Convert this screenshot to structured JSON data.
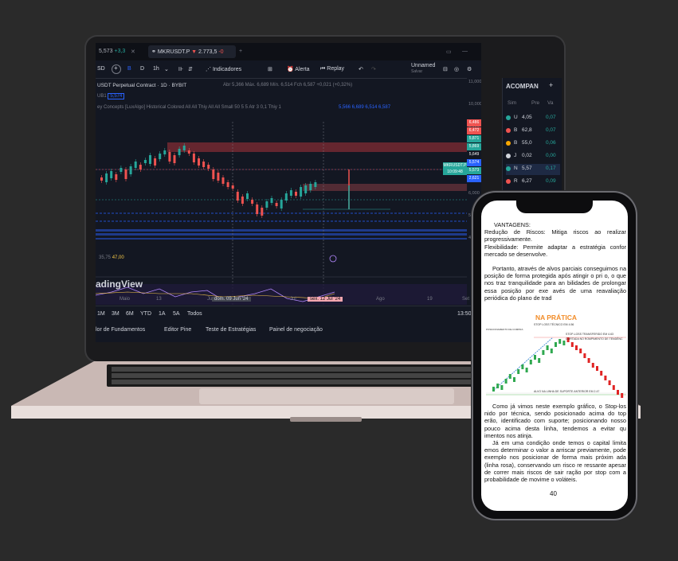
{
  "toolbar": {
    "tab_left": "5,573",
    "tab_left_change": "+3,3",
    "tab_symbol": "MKRUSDT.P",
    "tab_symbol_price": "2.773,5",
    "tab_symbol_change": "-0",
    "interval_b": "B",
    "interval_d": "D",
    "interval_1h": "1h",
    "indicators": "Indicadores",
    "alert": "Alerta",
    "replay": "Replay",
    "unnamed": "Unnamed",
    "unnamed_sub": "Salvar",
    "currency": "SD"
  },
  "chart": {
    "title": "USDT Perpetual Contract · 1D · BYBIT",
    "ohlc": "Abr 5,366  Máx. 6,689  Mín. 6,514  Fch 6,587  +0,021 (+0,32%)",
    "indicator_legend": "ey Concepts [LuxAlgo] Historical Colored All All Thiy All All Small 50 5 5 Atr 3 0,1 Thiy 1",
    "indicator_values": "5,566  6,689  6,514  6,587",
    "volume_label": "UB1",
    "volume_value": "5,574",
    "rsi_label": "35,75",
    "rsi_value": "47,00",
    "watermark": "adingView",
    "symbol_label": "MKRUSDT.P",
    "symbol_price": "5,573",
    "symbol_time": "10:09:48",
    "axis_prices": [
      "11,000",
      "10,000",
      "9,000",
      "8,000",
      "7,000",
      "6,000",
      "5,000",
      "4,000"
    ],
    "price_tags": [
      "6,486",
      "6,472",
      "5,871",
      "5,869",
      "5,649",
      "5,574",
      "5,573",
      "2,621"
    ],
    "time_labels": [
      "Maio",
      "13",
      "Ju",
      "Jul",
      "15",
      "Ago",
      "19",
      "Set"
    ],
    "crosshair_left": "dom. 09 Jun '24",
    "crosshair_right": "sex. 12 Jul '24",
    "ranges": [
      "1M",
      "3M",
      "6M",
      "YTD",
      "1A",
      "5A",
      "Todos"
    ],
    "clock": "13:50",
    "bottom_tabs": [
      "lor de Fundamentos",
      "Editor Pine",
      "Teste de Estratégias",
      "Painel de negociação"
    ]
  },
  "watchlist": {
    "title": "ACOMPAN",
    "col_sim": "Sim",
    "col_pre": "Pre",
    "col_var": "Va",
    "rows": [
      {
        "sym": "U",
        "price": "4,05",
        "chg": "0,07",
        "color": "#26a69a"
      },
      {
        "sym": "B",
        "price": "62,8",
        "chg": "0,07",
        "color": "#ef5350"
      },
      {
        "sym": "B",
        "price": "55,0",
        "chg": "0,06",
        "color": "#f7a600"
      },
      {
        "sym": "J",
        "price": "0,02",
        "chg": "0,00",
        "color": "#d1d4dc"
      },
      {
        "sym": "N",
        "price": "5,57",
        "chg": "0,17",
        "color": "#26a69a"
      },
      {
        "sym": "R",
        "price": "6,27",
        "chg": "0,09",
        "color": "#ef5350"
      }
    ]
  },
  "document": {
    "heading": "VANTAGENS:",
    "bullet1": "Redução de Riscos: Mitiga riscos ao realizar progressivamente.",
    "bullet2": "Flexibilidade: Permite adaptar a estratégia confor mercado se desenvolve.",
    "para1": "Portanto, através de alvos parciais conseguimos na posição de forma protegida após atingir o pri o, o que nos traz tranquilidade para an bilidades de prolongar essa posição por exe avés de uma reavaliação periódica do plano de trad",
    "figure_title": "NA PRÁTICA",
    "figure_notes": [
      "STOP LOSS TÉCNICO EM 4.56",
      "STOP-LOSS TRANSFERIDO EM 4.63",
      "CORTADA NO ROMPIMENTO DE TENDÊNC",
      "ALVO NA LINHA DE SUPORTE ANTERIOR EM 2.47",
      "POSICIONAMENTO DE COMPRA"
    ],
    "para2": "Como já vimos neste exemplo gráfico, o Stop-los nido por técnica, sendo posicionado acima do top erão, identificado com suporte; posicionando nosso pouco acima desta linha, tendemos a evitar qu imentos nos atinja.",
    "para3": "Já em uma condição onde temos o capital limita emos determinar o valor a arriscar previamente, pode exemplo nos posicionar de forma mais próxim ada (linha rosa), conservando um risco re ressante apesar de correr mais riscos de sair ração por stop com a probabilidade de movime o voláteis.",
    "page_number": "40"
  }
}
